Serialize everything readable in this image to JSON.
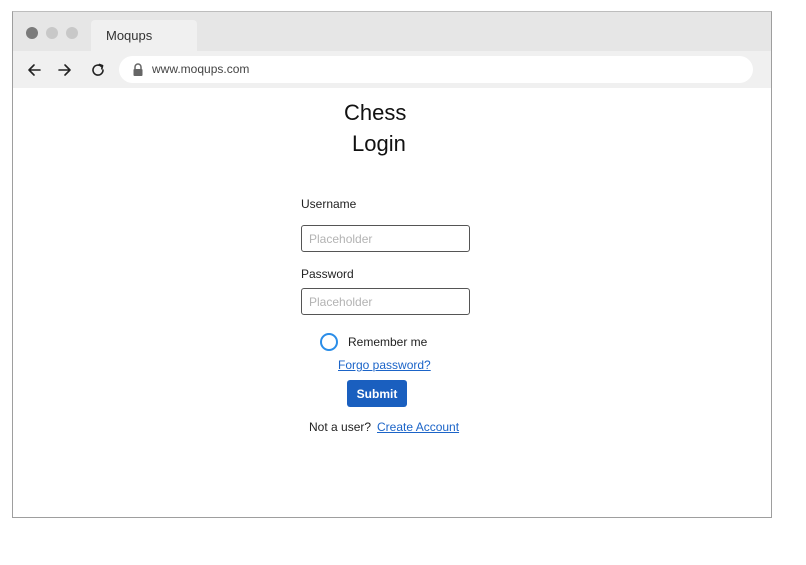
{
  "browser": {
    "tab_title": "Moqups",
    "url": "www.moqups.com",
    "icons": {
      "back": "arrow-left-icon",
      "forward": "arrow-right-icon",
      "reload": "reload-icon",
      "lock": "lock-icon"
    }
  },
  "page": {
    "title_line1": "Chess",
    "title_line2": "Login"
  },
  "form": {
    "username_label": "Username",
    "username_placeholder": "Placeholder",
    "username_value": "",
    "password_label": "Password",
    "password_placeholder": "Placeholder",
    "password_value": "",
    "remember_label": "Remember me",
    "remember_checked": false,
    "forgot_link": "Forgo password?",
    "submit_label": "Submit",
    "not_user_text": "Not a user?",
    "create_account_link": "Create Account"
  },
  "colors": {
    "submit_bg": "#1a5fbf",
    "link": "#1b64c8",
    "radio_ring": "#2a8de8"
  }
}
